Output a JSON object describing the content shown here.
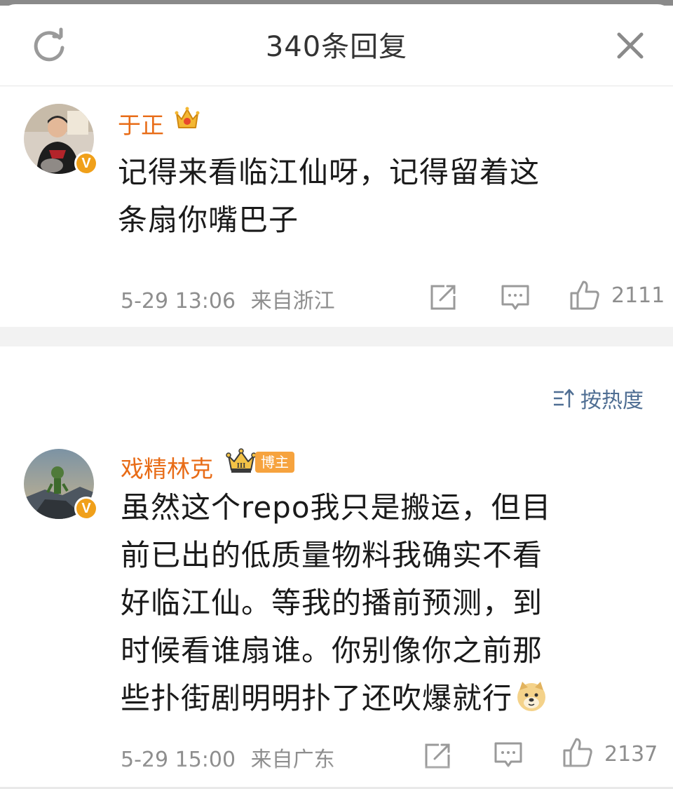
{
  "header": {
    "title": "340条回复"
  },
  "comments": [
    {
      "username": "于正",
      "text_line1": "记得来看临江仙呀，记得留着这",
      "text_line2": "条扇你嘴巴子",
      "time": "5-29 13:06",
      "location": "来自浙江",
      "likes": "2111"
    },
    {
      "username": "戏精林克",
      "tag": "博主",
      "text_line1": "虽然这个repo我只是搬运，但目",
      "text_line2": "前已出的低质量物料我确实不看",
      "text_line3": "好临江仙。等我的播前预测，到",
      "text_line4": "时候看谁扇谁。你别像你之前那",
      "text_line5": "些扑街剧明明扑了还吹爆就行",
      "time": "5-29 15:00",
      "location": "来自广东",
      "likes": "2137"
    }
  ],
  "sort": {
    "label": "按热度"
  },
  "badges": {
    "verified": "V",
    "crown_level": "III"
  },
  "colors": {
    "username": "#e86c17",
    "sort_link": "#4f6e93",
    "meta_gray": "#8e8e8e",
    "badge_orange": "#f0a01a"
  }
}
